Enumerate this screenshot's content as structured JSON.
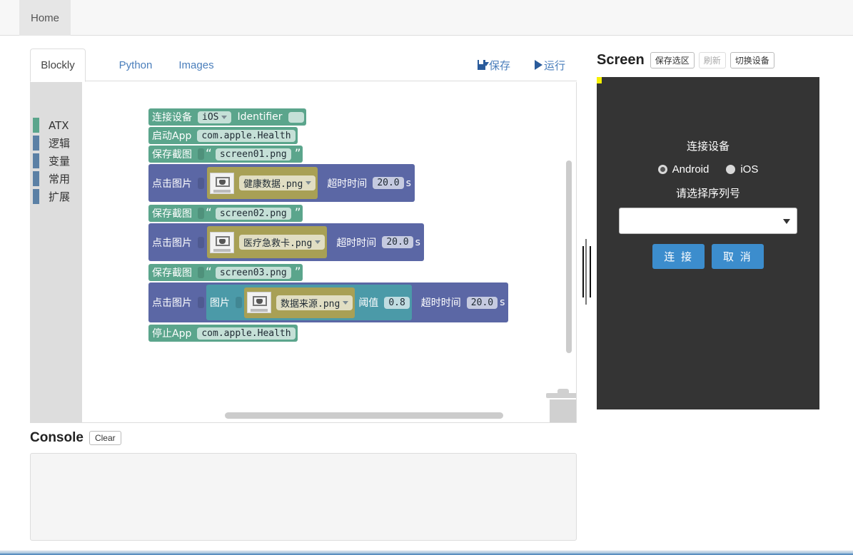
{
  "window": {
    "tabs": [
      {
        "label": "Home",
        "active": true
      }
    ]
  },
  "editor": {
    "tabs": [
      {
        "label": "Blockly",
        "active": true
      },
      {
        "label": "Python",
        "active": false
      },
      {
        "label": "Images",
        "active": false
      }
    ],
    "toolbar": {
      "save_label": "保存",
      "save_icon": "floppy-disk-icon",
      "run_label": "运行",
      "run_icon": "play-icon"
    },
    "palette": {
      "items": [
        {
          "label": "ATX",
          "color": "#5ba58c"
        },
        {
          "label": "逻辑",
          "color": "#5b80a5"
        },
        {
          "label": "变量",
          "color": "#5b80a5"
        },
        {
          "label": "常用",
          "color": "#5b80a5"
        },
        {
          "label": "扩展",
          "color": "#5b80a5"
        }
      ]
    },
    "blocks": [
      {
        "id": "connect-device",
        "kind": "connect_device",
        "label": "连接设备",
        "platform_value": "iOS",
        "identifier_label": "Identifier",
        "identifier_value": ""
      },
      {
        "id": "start-app",
        "kind": "start_app",
        "label": "启动App",
        "package": "com.apple.Health"
      },
      {
        "id": "save-screenshot-1",
        "kind": "save_screenshot",
        "label": "保存截图",
        "filename": "screen01.png"
      },
      {
        "id": "click-image-1",
        "kind": "click_image",
        "label": "点击图片",
        "image_name": "健康数据.png",
        "timeout_label": "超时时间",
        "timeout_value": "20.0",
        "timeout_unit": "s"
      },
      {
        "id": "save-screenshot-2",
        "kind": "save_screenshot",
        "label": "保存截图",
        "filename": "screen02.png"
      },
      {
        "id": "click-image-2",
        "kind": "click_image",
        "label": "点击图片",
        "image_name": "医疗急救卡.png",
        "timeout_label": "超时时间",
        "timeout_value": "20.0",
        "timeout_unit": "s"
      },
      {
        "id": "save-screenshot-3",
        "kind": "save_screenshot",
        "label": "保存截图",
        "filename": "screen03.png"
      },
      {
        "id": "click-image-3",
        "kind": "click_image_threshold",
        "label": "点击图片",
        "image_socket_label": "图片",
        "image_name": "数据来源.png",
        "threshold_label": "阈值",
        "threshold_value": "0.8",
        "timeout_label": "超时时间",
        "timeout_value": "20.0",
        "timeout_unit": "s"
      },
      {
        "id": "stop-app",
        "kind": "stop_app",
        "label": "停止App",
        "package": "com.apple.Health"
      }
    ],
    "trash_icon": "trash-can-icon"
  },
  "screen": {
    "title": "Screen",
    "buttons": [
      {
        "label": "保存选区",
        "disabled": false
      },
      {
        "label": "刷新",
        "disabled": true
      },
      {
        "label": "切换设备",
        "disabled": false
      }
    ],
    "dialog": {
      "title": "连接设备",
      "options": [
        {
          "label": "Android",
          "selected": true
        },
        {
          "label": "iOS",
          "selected": false
        }
      ],
      "serial_label": "请选择序列号",
      "serial_value": "",
      "connect_label": "连 接",
      "cancel_label": "取 消"
    }
  },
  "console": {
    "title": "Console",
    "clear_label": "Clear",
    "output": ""
  }
}
